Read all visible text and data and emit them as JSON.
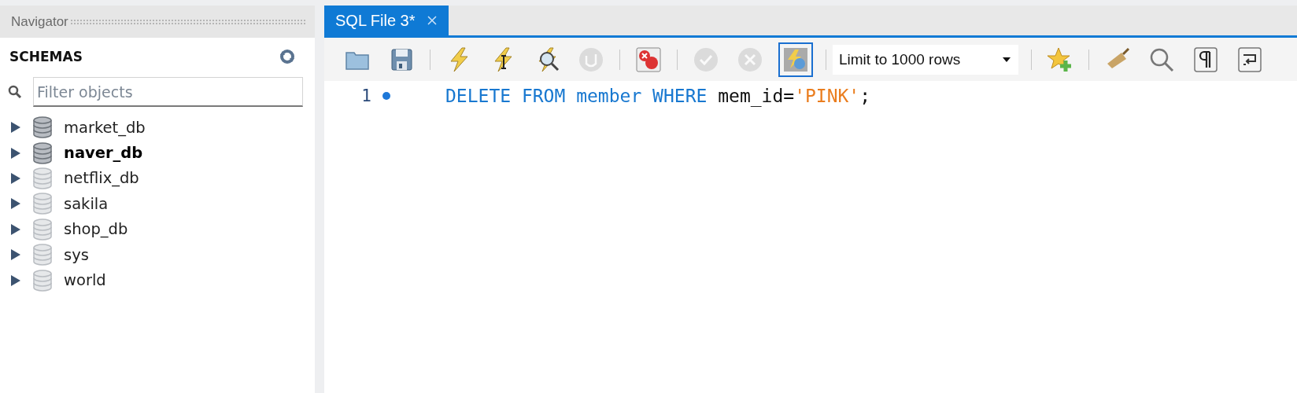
{
  "navigator": {
    "title": "Navigator",
    "section": "SCHEMAS",
    "filter": {
      "placeholder": "Filter objects"
    },
    "schemas": [
      {
        "name": "market_db",
        "default": false,
        "loaded": true
      },
      {
        "name": "naver_db",
        "default": true,
        "loaded": true
      },
      {
        "name": "netflix_db",
        "default": false,
        "loaded": false
      },
      {
        "name": "sakila",
        "default": false,
        "loaded": false
      },
      {
        "name": "shop_db",
        "default": false,
        "loaded": false
      },
      {
        "name": "sys",
        "default": false,
        "loaded": false
      },
      {
        "name": "world",
        "default": false,
        "loaded": false
      }
    ]
  },
  "tabs": [
    {
      "label": "SQL File 3*",
      "selected": true
    }
  ],
  "toolbar": [
    {
      "kind": "open",
      "disabled": false
    },
    {
      "kind": "save",
      "disabled": false
    },
    {
      "kind": "separator"
    },
    {
      "kind": "execute",
      "disabled": false
    },
    {
      "kind": "execute-current",
      "disabled": false
    },
    {
      "kind": "explain",
      "disabled": false
    },
    {
      "kind": "stop",
      "disabled": true
    },
    {
      "kind": "separator"
    },
    {
      "kind": "stop-on-error",
      "disabled": false
    },
    {
      "kind": "separator"
    },
    {
      "kind": "commit",
      "disabled": true
    },
    {
      "kind": "rollback",
      "disabled": true
    },
    {
      "kind": "autocommit",
      "disabled": false,
      "selected": true
    },
    {
      "kind": "separator"
    },
    {
      "kind": "limit",
      "value": "Limit to 1000 rows"
    },
    {
      "kind": "separator"
    },
    {
      "kind": "snippet",
      "disabled": false
    },
    {
      "kind": "separator"
    },
    {
      "kind": "beautify",
      "disabled": false
    },
    {
      "kind": "find",
      "disabled": false
    },
    {
      "kind": "invisibles",
      "disabled": false
    },
    {
      "kind": "wrap",
      "disabled": false
    }
  ],
  "editor": {
    "lines": [
      {
        "number": "1",
        "marker": true,
        "tokens": [
          {
            "kind": "keyword",
            "text": "DELETE FROM member WHERE"
          },
          {
            "kind": "plain",
            "text": " mem_id="
          },
          {
            "kind": "string",
            "text": "'PINK'"
          },
          {
            "kind": "plain",
            "text": ";"
          }
        ]
      }
    ]
  }
}
